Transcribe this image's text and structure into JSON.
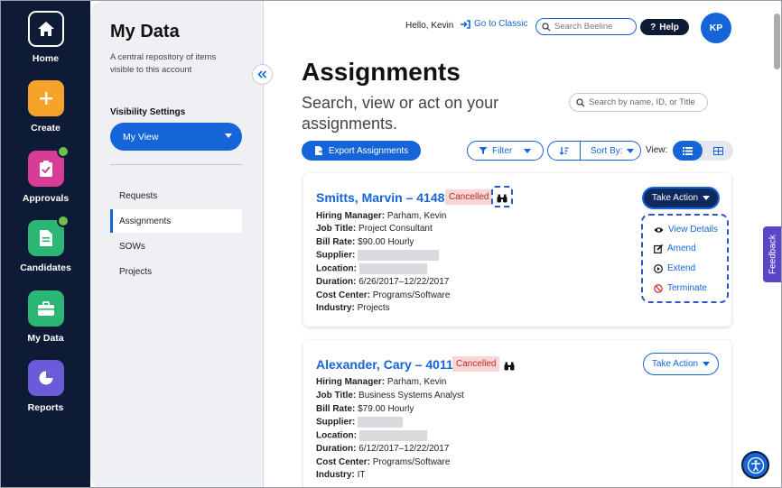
{
  "rail": {
    "items": [
      {
        "label": "Home",
        "icon": "home-icon",
        "color": "#0d1b36"
      },
      {
        "label": "Create",
        "icon": "plus-icon",
        "color": "#f5a32a"
      },
      {
        "label": "Approvals",
        "icon": "clipboard-check-icon",
        "color": "#d83c94"
      },
      {
        "label": "Candidates",
        "icon": "document-icon",
        "color": "#2bb673"
      },
      {
        "label": "My Data",
        "icon": "briefcase-icon",
        "color": "#2bb673"
      },
      {
        "label": "Reports",
        "icon": "pie-chart-icon",
        "color": "#6a5bd8"
      }
    ]
  },
  "sidebar": {
    "title": "My Data",
    "description": "A central repository of items visible to this account",
    "visibility_label": "Visibility Settings",
    "visibility_value": "My View",
    "nav": [
      {
        "label": "Requests",
        "active": false
      },
      {
        "label": "Assignments",
        "active": true
      },
      {
        "label": "SOWs",
        "active": false
      },
      {
        "label": "Projects",
        "active": false
      }
    ]
  },
  "header": {
    "greeting": "Hello, Kevin",
    "classic_link": "Go to Classic",
    "search_placeholder": "Search Beeline",
    "help_label": "Help",
    "avatar_initials": "KP"
  },
  "main": {
    "title": "Assignments",
    "subtitle": "Search, view or act on your assignments.",
    "search_placeholder": "Search by name, ID, or Title",
    "export_label": "Export Assignments",
    "filter_label": "Filter",
    "sort_label": "Sort By:",
    "view_label": "View:"
  },
  "cards": [
    {
      "name": "Smitts, Marvin – 4148",
      "status": "Cancelled",
      "action_label": "Take Action",
      "fields": [
        {
          "label": "Hiring Manager:",
          "value": "Parham, Kevin"
        },
        {
          "label": "Job Title:",
          "value": "Project Consultant"
        },
        {
          "label": "Bill Rate:",
          "value": "$90.00 Hourly"
        },
        {
          "label": "Supplier:",
          "value": ""
        },
        {
          "label": "Location:",
          "value": ""
        },
        {
          "label": "Duration:",
          "value": "6/26/2017–12/22/2017"
        },
        {
          "label": "Cost Center:",
          "value": "Programs/Software"
        },
        {
          "label": "Industry:",
          "value": "Projects"
        }
      ]
    },
    {
      "name": "Alexander, Cary – 4011",
      "status": "Cancelled",
      "action_label": "Take Action",
      "fields": [
        {
          "label": "Hiring Manager:",
          "value": "Parham, Kevin"
        },
        {
          "label": "Job Title:",
          "value": "Business Systems Analyst"
        },
        {
          "label": "Bill Rate:",
          "value": "$79.00 Hourly"
        },
        {
          "label": "Supplier:",
          "value": ""
        },
        {
          "label": "Location:",
          "value": ""
        },
        {
          "label": "Duration:",
          "value": "6/12/2017–12/22/2017"
        },
        {
          "label": "Cost Center:",
          "value": "Programs/Software"
        },
        {
          "label": "Industry:",
          "value": "IT"
        }
      ]
    }
  ],
  "action_menu": {
    "items": [
      {
        "label": "View Details",
        "icon": "eye-icon"
      },
      {
        "label": "Amend",
        "icon": "edit-icon"
      },
      {
        "label": "Extend",
        "icon": "play-circle-icon"
      },
      {
        "label": "Terminate",
        "icon": "ban-icon"
      }
    ]
  },
  "feedback_label": "Feedback",
  "colors": {
    "primary": "#1565d8",
    "rail_bg": "#0d1b36",
    "status_bg": "#f9d6d6",
    "status_text": "#b62a2a"
  }
}
